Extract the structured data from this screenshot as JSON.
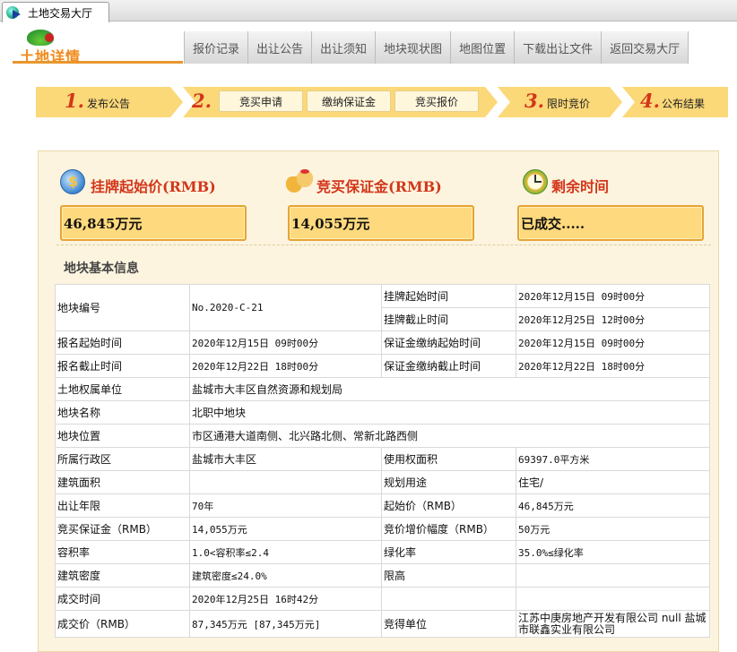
{
  "browser": {
    "tab_title": "土地交易大厅"
  },
  "logo_text": "土地详情",
  "nav": [
    "报价记录",
    "出让公告",
    "出让须知",
    "地块现状图",
    "地图位置",
    "下载出让文件",
    "返回交易大厅"
  ],
  "steps": [
    {
      "num": "1.",
      "label": "发布公告"
    },
    {
      "num": "2.",
      "label": "",
      "substeps": [
        "竞买申请",
        "缴纳保证金",
        "竞买报价"
      ]
    },
    {
      "num": "3.",
      "label": "限时竞价"
    },
    {
      "num": "4.",
      "label": "公布结果"
    }
  ],
  "stats": {
    "start_price": {
      "title": "挂牌起始价(RMB)",
      "value": "46,845万元"
    },
    "deposit": {
      "title": "竞买保证金(RMB)",
      "value": "14,055万元"
    },
    "remaining": {
      "title": "剩余时间",
      "value": "已成交....."
    }
  },
  "section_title": "地块基本信息",
  "table": {
    "r1": {
      "k1": "地块编号",
      "v1": "No.2020-C-21",
      "k2a": "挂牌起始时间",
      "v2a": "2020年12月15日 09时00分",
      "k2b": "挂牌截止时间",
      "v2b": "2020年12月25日 12时00分"
    },
    "r2": {
      "k1": "报名起始时间",
      "v1": "2020年12月15日 09时00分",
      "k2": "保证金缴纳起始时间",
      "v2": "2020年12月15日 09时00分"
    },
    "r3": {
      "k1": "报名截止时间",
      "v1": "2020年12月22日 18时00分",
      "k2": "保证金缴纳截止时间",
      "v2": "2020年12月22日 18时00分"
    },
    "r4": {
      "k1": "土地权属单位",
      "v1": "盐城市大丰区自然资源和规划局"
    },
    "r5": {
      "k1": "地块名称",
      "v1": "北职中地块"
    },
    "r6": {
      "k1": "地块位置",
      "v1": "市区通港大道南侧、北兴路北侧、常新北路西侧"
    },
    "r7": {
      "k1": "所属行政区",
      "v1": "盐城市大丰区",
      "k2": "使用权面积",
      "v2": "69397.0平方米"
    },
    "r8": {
      "k1": "建筑面积",
      "v1": "",
      "k2": "规划用途",
      "v2": "住宅/"
    },
    "r9": {
      "k1": "出让年限",
      "v1": "70年",
      "k2": "起始价（RMB）",
      "v2": "46,845万元"
    },
    "r10": {
      "k1": "竞买保证金（RMB）",
      "v1": "14,055万元",
      "k2": "竞价增价幅度（RMB）",
      "v2": "50万元"
    },
    "r11": {
      "k1": "容积率",
      "v1": "1.0<容积率≤2.4",
      "k2": "绿化率",
      "v2": "35.0%≤绿化率"
    },
    "r12": {
      "k1": "建筑密度",
      "v1": "建筑密度≤24.0%",
      "k2": "限高",
      "v2": ""
    },
    "r13": {
      "k1": "成交时间",
      "v1": "2020年12月25日 16时42分",
      "k2": "",
      "v2": ""
    },
    "r14": {
      "k1": "成交价（RMB）",
      "v1": "87,345万元 [87,345万元]",
      "k2": "竞得单位",
      "v2": "江苏中庚房地产开发有限公司 null 盐城市联鑫实业有限公司"
    }
  }
}
